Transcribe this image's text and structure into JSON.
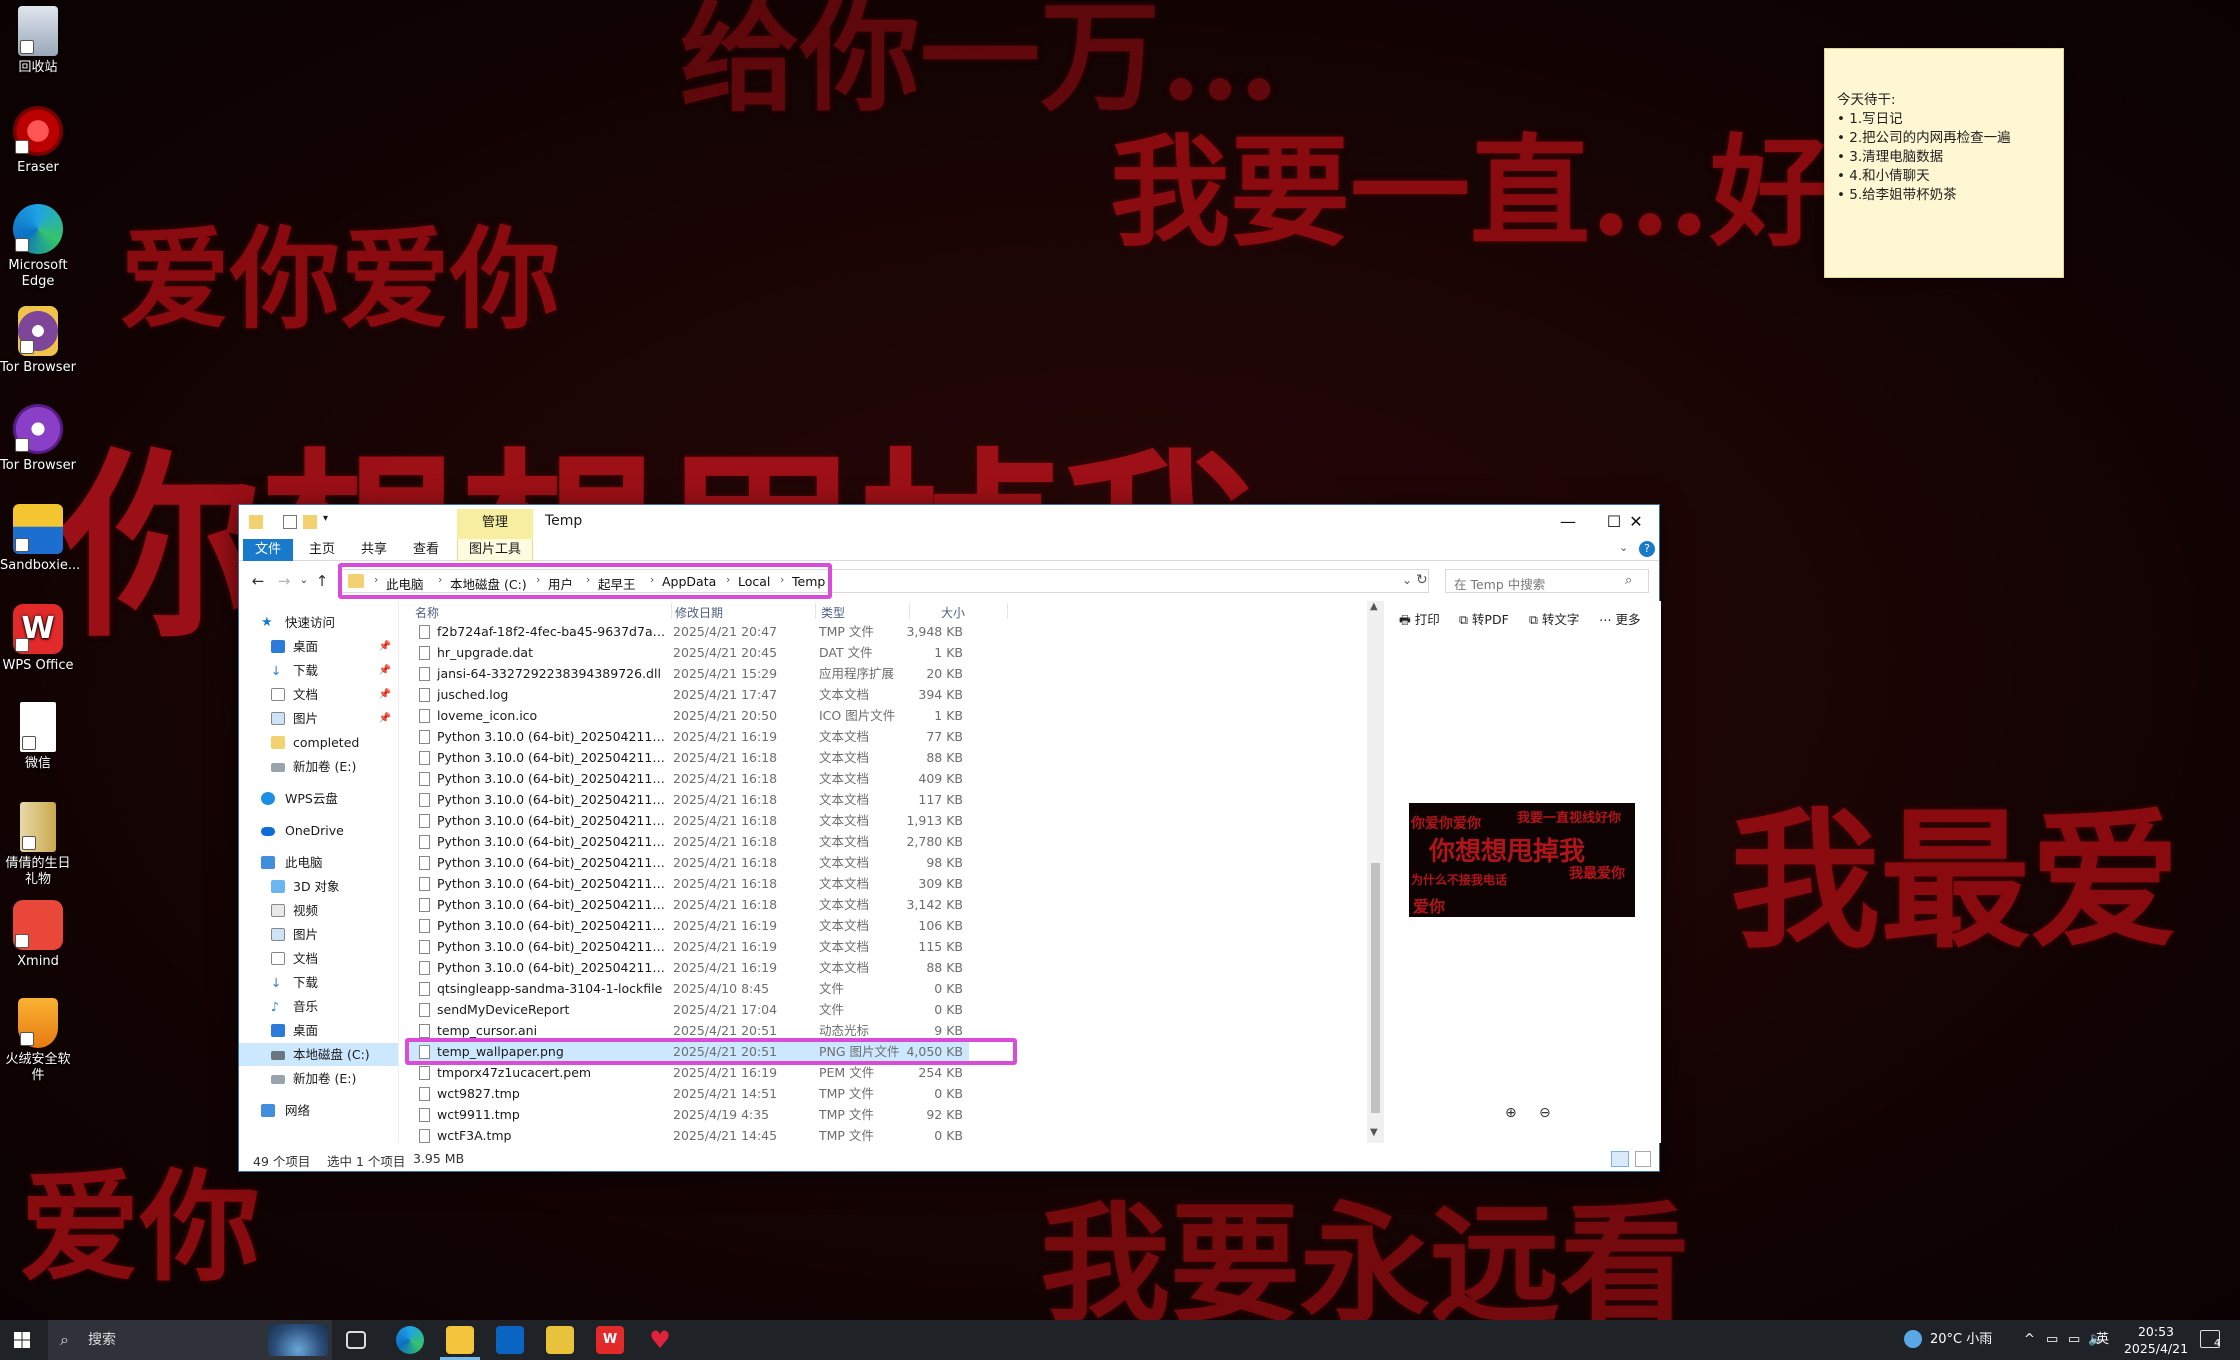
{
  "desktop": {
    "wallpaper_lines": [
      "给你一万…",
      "我要一直…好",
      "爱你爱你",
      "你想想甩掉我",
      "我最爱",
      "爱你",
      "我要永远看"
    ],
    "icons": [
      {
        "label": "回收站"
      },
      {
        "label": "Eraser"
      },
      {
        "label": "Microsoft Edge"
      },
      {
        "label": "Tor Browser"
      },
      {
        "label": "Tor Browser"
      },
      {
        "label": "Sandboxie..."
      },
      {
        "label": "WPS Office"
      },
      {
        "label": "微信"
      },
      {
        "label": "倩倩的生日礼物"
      },
      {
        "label": "Xmind"
      },
      {
        "label": "火绒安全软件"
      }
    ],
    "sticky_note": {
      "title": "今天待干:",
      "items": [
        "• 1.写日记",
        "• 2.把公司的内网再检查一遍",
        "• 3.清理电脑数据",
        "• 4.和小倩聊天",
        "• 5.给李姐带杯奶茶"
      ]
    }
  },
  "explorer": {
    "title": "Temp",
    "context_tab": "管理",
    "context_subtab": "图片工具",
    "ribbon_tabs": [
      "文件",
      "主页",
      "共享",
      "查看"
    ],
    "breadcrumb": [
      "此电脑",
      "本地磁盘 (C:)",
      "用户",
      "起早王",
      "AppData",
      "Local",
      "Temp"
    ],
    "search_placeholder": "在 Temp 中搜索",
    "nav": {
      "quick_access": "快速访问",
      "quick_items": [
        "桌面",
        "下载",
        "文档",
        "图片",
        "completed",
        "新加卷 (E:)"
      ],
      "wps": "WPS云盘",
      "onedrive": "OneDrive",
      "this_pc": "此电脑",
      "pc_items": [
        "3D 对象",
        "视频",
        "图片",
        "文档",
        "下载",
        "音乐",
        "桌面",
        "本地磁盘 (C:)",
        "新加卷 (E:)"
      ],
      "network": "网络"
    },
    "columns": {
      "name": "名称",
      "date": "修改日期",
      "type": "类型",
      "size": "大小"
    },
    "files": [
      {
        "name": "f2b724af-18f2-4fec-ba45-9637d7aa8...",
        "date": "2025/4/21 20:47",
        "type": "TMP 文件",
        "size": "3,948 KB"
      },
      {
        "name": "hr_upgrade.dat",
        "date": "2025/4/21 20:45",
        "type": "DAT 文件",
        "size": "1 KB"
      },
      {
        "name": "jansi-64-3327292238394389726.dll",
        "date": "2025/4/21 15:29",
        "type": "应用程序扩展",
        "size": "20 KB"
      },
      {
        "name": "jusched.log",
        "date": "2025/4/21 17:47",
        "type": "文本文档",
        "size": "394 KB"
      },
      {
        "name": "loveme_icon.ico",
        "date": "2025/4/21 20:50",
        "type": "ICO 图片文件",
        "size": "1 KB"
      },
      {
        "name": "Python 3.10.0 (64-bit)_202504211618...",
        "date": "2025/4/21 16:19",
        "type": "文本文档",
        "size": "77 KB"
      },
      {
        "name": "Python 3.10.0 (64-bit)_202504211618...",
        "date": "2025/4/21 16:18",
        "type": "文本文档",
        "size": "88 KB"
      },
      {
        "name": "Python 3.10.0 (64-bit)_202504211618...",
        "date": "2025/4/21 16:18",
        "type": "文本文档",
        "size": "409 KB"
      },
      {
        "name": "Python 3.10.0 (64-bit)_202504211618...",
        "date": "2025/4/21 16:18",
        "type": "文本文档",
        "size": "117 KB"
      },
      {
        "name": "Python 3.10.0 (64-bit)_202504211618...",
        "date": "2025/4/21 16:18",
        "type": "文本文档",
        "size": "1,913 KB"
      },
      {
        "name": "Python 3.10.0 (64-bit)_202504211618...",
        "date": "2025/4/21 16:18",
        "type": "文本文档",
        "size": "2,780 KB"
      },
      {
        "name": "Python 3.10.0 (64-bit)_202504211618...",
        "date": "2025/4/21 16:18",
        "type": "文本文档",
        "size": "98 KB"
      },
      {
        "name": "Python 3.10.0 (64-bit)_202504211618...",
        "date": "2025/4/21 16:18",
        "type": "文本文档",
        "size": "309 KB"
      },
      {
        "name": "Python 3.10.0 (64-bit)_202504211618...",
        "date": "2025/4/21 16:18",
        "type": "文本文档",
        "size": "3,142 KB"
      },
      {
        "name": "Python 3.10.0 (64-bit)_202504211618...",
        "date": "2025/4/21 16:19",
        "type": "文本文档",
        "size": "106 KB"
      },
      {
        "name": "Python 3.10.0 (64-bit)_202504211618...",
        "date": "2025/4/21 16:19",
        "type": "文本文档",
        "size": "115 KB"
      },
      {
        "name": "Python 3.10.0 (64-bit)_202504211618...",
        "date": "2025/4/21 16:19",
        "type": "文本文档",
        "size": "88 KB"
      },
      {
        "name": "qtsingleapp-sandma-3104-1-lockfile",
        "date": "2025/4/10 8:45",
        "type": "文件",
        "size": "0 KB"
      },
      {
        "name": "sendMyDeviceReport",
        "date": "2025/4/21 17:04",
        "type": "文件",
        "size": "0 KB"
      },
      {
        "name": "temp_cursor.ani",
        "date": "2025/4/21 20:51",
        "type": "动态光标",
        "size": "9 KB"
      },
      {
        "name": "temp_wallpaper.png",
        "date": "2025/4/21 20:51",
        "type": "PNG 图片文件",
        "size": "4,050 KB",
        "selected": true
      },
      {
        "name": "tmporx47z1ucacert.pem",
        "date": "2025/4/21 16:19",
        "type": "PEM 文件",
        "size": "254 KB"
      },
      {
        "name": "wct9827.tmp",
        "date": "2025/4/21 14:51",
        "type": "TMP 文件",
        "size": "0 KB"
      },
      {
        "name": "wct9911.tmp",
        "date": "2025/4/19 4:35",
        "type": "TMP 文件",
        "size": "92 KB"
      },
      {
        "name": "wctF3A.tmp",
        "date": "2025/4/21 14:45",
        "type": "TMP 文件",
        "size": "0 KB"
      }
    ],
    "preview_toolbar": [
      "打印",
      "转PDF",
      "转文字",
      "更多"
    ],
    "preview_image_text": [
      "你爱你爱你",
      "我要一直视线好你",
      "你想想甩掉我",
      "为什么不接我电话",
      "我最爱你",
      "爱你"
    ],
    "status": {
      "count": "49 个项目",
      "selected": "选中 1 个项目",
      "size": "3.95 MB"
    }
  },
  "taskbar": {
    "search_label": "搜索",
    "weather": "20°C 小雨",
    "ime": "英",
    "time": "20:53",
    "date": "2025/4/21",
    "notification_count": "4"
  }
}
